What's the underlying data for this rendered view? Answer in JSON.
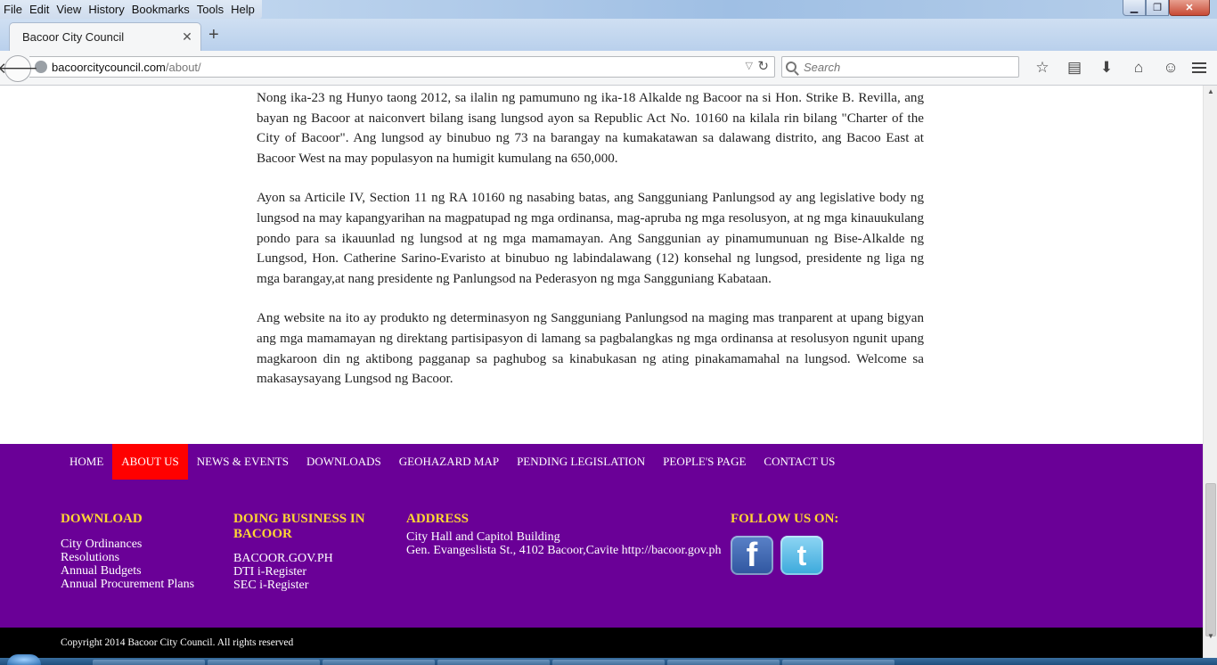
{
  "browser": {
    "menu": [
      "File",
      "Edit",
      "View",
      "History",
      "Bookmarks",
      "Tools",
      "Help"
    ],
    "tab_title": "Bacoor City Council",
    "url_domain": "bacoorcitycouncil.com",
    "url_path": "/about/",
    "search_placeholder": "Search"
  },
  "article": {
    "paragraphs": [
      "Nong ika-23 ng Hunyo taong 2012, sa ilalin ng pamumuno ng ika-18 Alkalde ng Bacoor na si Hon. Strike B. Revilla, ang bayan ng Bacoor at naiconvert bilang isang lungsod ayon sa Republic Act No. 10160 na kilala rin bilang \"Charter of the City of Bacoor\". Ang lungsod ay binubuo ng 73 na barangay na kumakatawan sa dalawang distrito, ang Bacoo East at Bacoor West na may populasyon na humigit kumulang na 650,000.",
      "Ayon sa Articile IV, Section 11 ng RA 10160 ng nasabing batas, ang Sangguniang Panlungsod ay ang legislative body ng lungsod na may kapangyarihan na magpatupad ng mga ordinansa, mag-apruba ng mga resolusyon, at ng mga kinauukulang pondo para sa ikauunlad ng lungsod at ng mga mamamayan. Ang Sanggunian ay pinamumunuan ng Bise-Alkalde ng Lungsod, Hon. Catherine Sarino-Evaristo at binubuo ng labindalawang (12) konsehal ng lungsod, presidente ng liga ng mga barangay,at nang presidente ng Panlungsod na Pederasyon ng mga Sangguniang Kabataan.",
      "Ang website na ito ay produkto ng determinasyon ng Sangguniang Panlungsod na maging mas tranparent at upang bigyan ang mga mamamayan ng direktang partisipasyon di lamang sa pagbalangkas ng mga ordinansa at resolusyon ngunit upang magkaroon din ng aktibong pagganap sa paghubog sa kinabukasan ng ating pinakamamahal na lungsod. Welcome sa makasaysayang Lungsod ng Bacoor."
    ]
  },
  "footer_nav": {
    "items": [
      "HOME",
      "ABOUT US",
      "NEWS & EVENTS",
      "DOWNLOADS",
      "GEOHAZARD MAP",
      "PENDING LEGISLATION",
      "PEOPLE'S PAGE",
      "CONTACT US"
    ],
    "active": "ABOUT US"
  },
  "footer": {
    "download": {
      "heading": "DOWNLOAD",
      "links": [
        "City Ordinances",
        "Resolutions",
        "Annual Budgets",
        "Annual Procurement Plans"
      ]
    },
    "business": {
      "heading": "DOING BUSINESS IN BACOOR",
      "links": [
        "BACOOR.GOV.PH",
        "DTI i-Register",
        "SEC i-Register"
      ]
    },
    "address": {
      "heading": "ADDRESS",
      "line1": "City Hall and Capitol Building",
      "line2": "Gen. Evangeslista St., 4102 Bacoor,Cavite http://bacoor.gov.ph"
    },
    "follow": {
      "heading": "FOLLOW US ON:",
      "facebook_glyph": "f",
      "twitter_glyph": "t"
    },
    "copyright": "Copyright 2014 Bacoor City Council. All rights reserved"
  },
  "colors": {
    "footer_bg": "#6a0097",
    "nav_active": "#ff0000",
    "heading": "#ffd633"
  }
}
